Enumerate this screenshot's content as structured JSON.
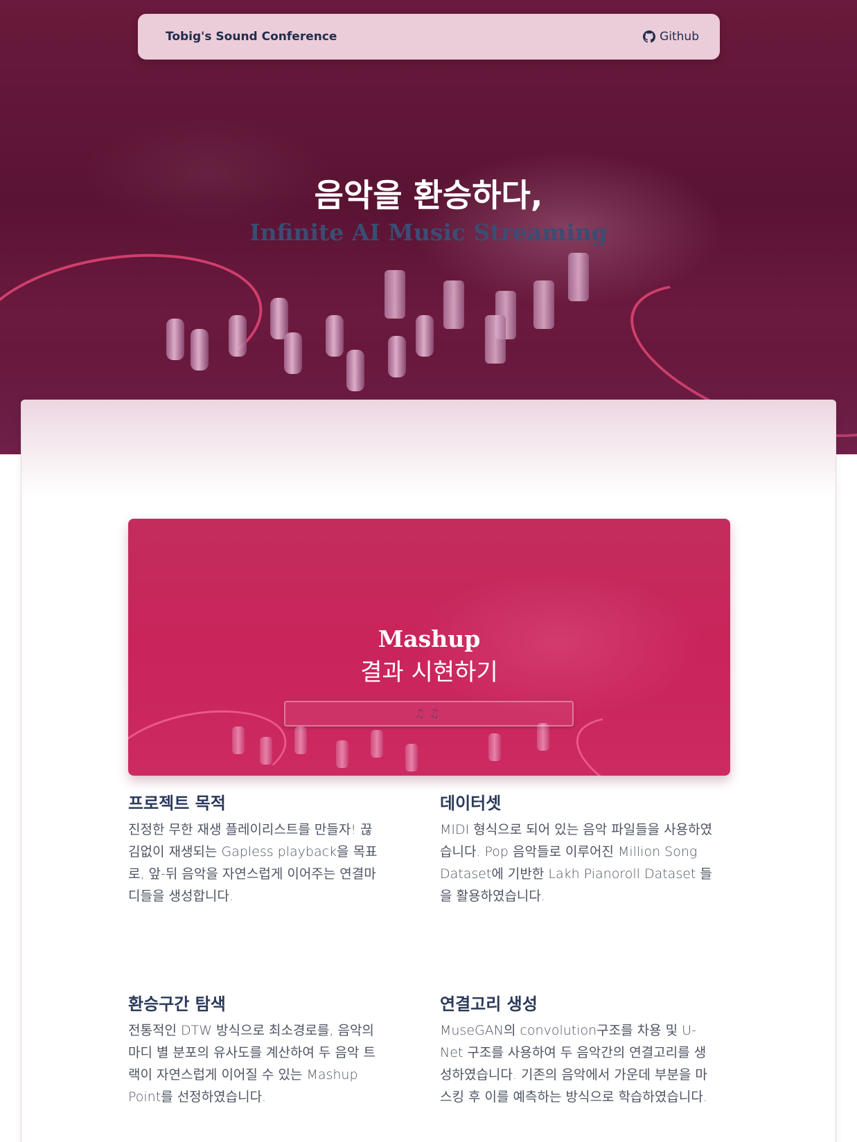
{
  "nav": {
    "brand": "Tobig's Sound Conference",
    "github_label": "Github"
  },
  "hero": {
    "title": "음악을 환승하다,",
    "subtitle": "Infinite AI Music Streaming"
  },
  "mashup": {
    "title": "Mashup",
    "subtitle": "결과 시현하기",
    "player_icon": "music-notes-icon"
  },
  "features": [
    {
      "title": "프로젝트 목적",
      "body": "진정한 무한 재생 플레이리스트를 만들자! 끊김없이 재생되는 Gapless playback을 목표로, 앞-뒤 음악을 자연스럽게 이어주는 연결마디들을 생성합니다."
    },
    {
      "title": "데이터셋",
      "body": "MIDI 형식으로 되어 있는 음악 파일들을 사용하였습니다. Pop 음악들로 이루어진 Million Song Dataset에 기반한 Lakh Pianoroll Dataset 들을 활용하였습니다."
    },
    {
      "title": "환승구간 탐색",
      "body": "전통적인 DTW 방식으로 최소경로를, 음악의 마디 별 분포의 유사도를 계산하여 두 음악 트랙이 자연스럽게 이어질 수 있는 Mashup Point를 선정하였습니다."
    },
    {
      "title": "연결고리 생성",
      "body": "MuseGAN의 convolution구조를 차용 및 U-Net 구조를 사용하여 두 음악간의 연결고리를 생성하였습니다. 기존의 음악에서 가운데 부분을 마스킹 후 이를 예측하는 방식으로 학습하였습니다."
    }
  ],
  "colors": {
    "hero_bg": "#5a1333",
    "navbar_bg": "#ebcdd9",
    "mashup_bg": "#c9245b",
    "heading": "#2b3a5a",
    "body_text": "#4e5463"
  }
}
